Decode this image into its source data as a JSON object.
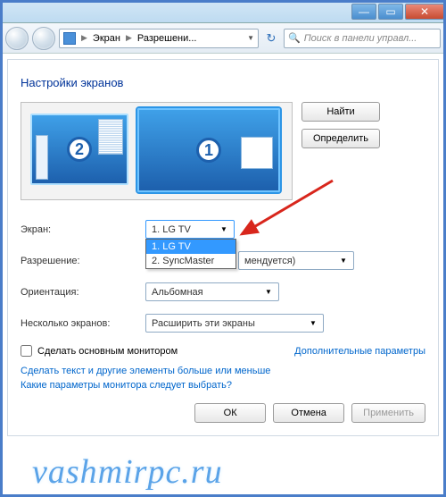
{
  "titlebar": {},
  "nav": {
    "crumb1": "Экран",
    "crumb2": "Разрешени...",
    "search_placeholder": "Поиск в панели управл..."
  },
  "heading": "Настройки экранов",
  "buttons": {
    "find": "Найти",
    "detect": "Определить",
    "ok": "ОК",
    "cancel": "Отмена",
    "apply": "Применить"
  },
  "monitors": {
    "m1_num": "1",
    "m2_num": "2"
  },
  "labels": {
    "screen": "Экран:",
    "resolution": "Разрешение:",
    "orientation": "Ориентация:",
    "multi": "Несколько экранов:",
    "make_main": "Сделать основным монитором",
    "extra_params": "Дополнительные параметры"
  },
  "values": {
    "screen": "1. LG TV",
    "resolution_suffix": "мендуется)",
    "orientation": "Альбомная",
    "multi": "Расширить эти экраны"
  },
  "screen_options": {
    "opt1": "1. LG TV",
    "opt2": "2. SyncMaster"
  },
  "links": {
    "text_size": "Сделать текст и другие элементы больше или меньше",
    "which_params": "Какие параметры монитора следует выбрать?"
  },
  "watermark": "vashmirpc.ru"
}
